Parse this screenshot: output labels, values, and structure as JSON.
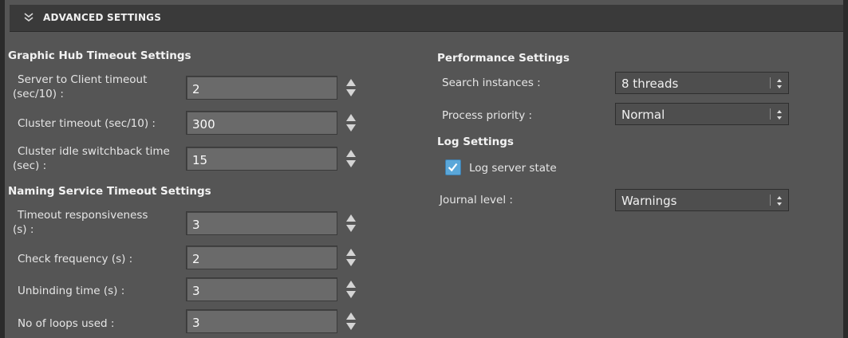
{
  "header": {
    "title": "ADVANCED SETTINGS",
    "icon": "double-chevron-down-icon"
  },
  "graphic_hub": {
    "title": "Graphic Hub Timeout Settings",
    "fields": [
      {
        "label_line1": "Server to Client timeout",
        "label_line2": "(sec/10) :",
        "value": "2"
      },
      {
        "label_line1": "Cluster timeout (sec/10) :",
        "label_line2": "",
        "value": "300"
      },
      {
        "label_line1": "Cluster idle switchback time",
        "label_line2": "(sec) :",
        "value": "15"
      }
    ]
  },
  "naming_service": {
    "title": "Naming Service Timeout Settings",
    "fields": [
      {
        "label_line1": "Timeout responsiveness",
        "label_line2": "(s) :",
        "value": "3"
      },
      {
        "label_line1": "Check frequency (s) :",
        "label_line2": "",
        "value": "2"
      },
      {
        "label_line1": "Unbinding time (s) :",
        "label_line2": "",
        "value": "3"
      },
      {
        "label_line1": "No of loops used :",
        "label_line2": "",
        "value": "3"
      }
    ]
  },
  "performance": {
    "title": "Performance Settings",
    "search_label": "Search instances :",
    "search_value": "8 threads",
    "priority_label": "Process priority :",
    "priority_value": "Normal"
  },
  "log": {
    "title": "Log Settings",
    "checkbox_label": "Log server state",
    "checkbox_checked": true,
    "journal_label": "Journal level :",
    "journal_value": "Warnings"
  },
  "colors": {
    "accent": "#5aa7d9",
    "panel": "#555555",
    "header": "#3a3a3a"
  }
}
